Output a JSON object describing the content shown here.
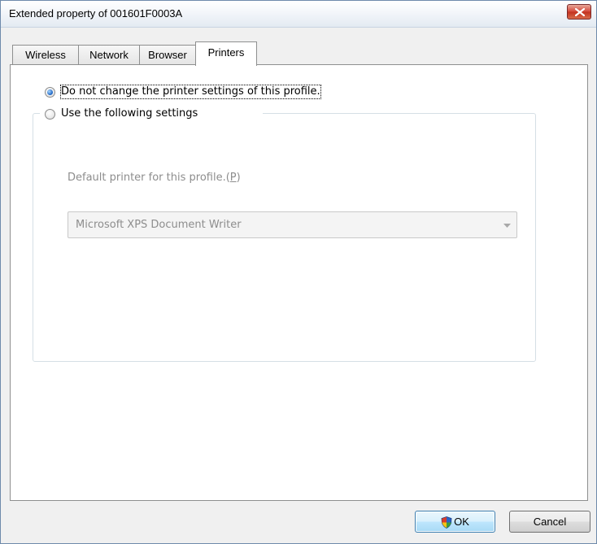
{
  "window": {
    "title": "Extended property of 001601F0003A"
  },
  "tabs": [
    {
      "label": "Wireless",
      "active": false
    },
    {
      "label": "Network",
      "active": false
    },
    {
      "label": "Browser",
      "active": false
    },
    {
      "label": "Printers",
      "active": true
    }
  ],
  "printers": {
    "option_no_change": {
      "label": "Do not change the printer settings of this profile.",
      "checked": true
    },
    "option_use_following": {
      "label": "Use the following settings",
      "checked": false
    },
    "default_printer_label": "Default printer for this profile.(P)",
    "default_printer_label_prefix": "Default printer for this profile.(",
    "default_printer_label_access": "P",
    "default_printer_label_suffix": ")",
    "default_printer_value": "Microsoft XPS Document Writer"
  },
  "buttons": {
    "ok_label": "OK",
    "cancel_label": "Cancel"
  },
  "icons": {
    "close": "close-icon",
    "shield": "uac-shield-icon",
    "dropdown": "chevron-down-icon"
  },
  "colors": {
    "close_button": "#d4483a",
    "radio_checked": "#1a62c2",
    "disabled_text": "#8d8d8d",
    "default_button_border": "#3c7fb1"
  }
}
